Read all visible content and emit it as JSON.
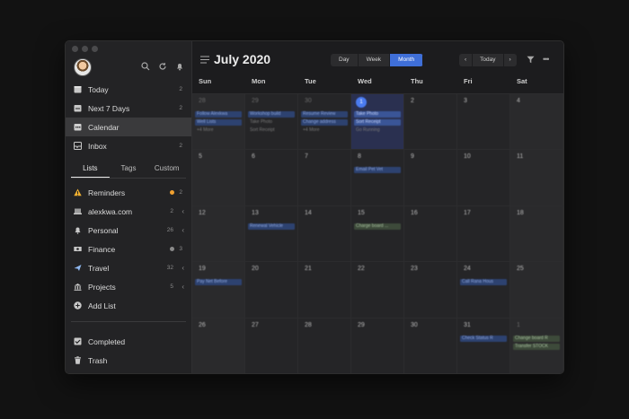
{
  "sidebar": {
    "nav": [
      {
        "label": "Today",
        "count": "2",
        "icon": "today-icon"
      },
      {
        "label": "Next 7 Days",
        "count": "2",
        "icon": "next-7-days-icon"
      },
      {
        "label": "Calendar",
        "count": "",
        "icon": "calendar-icon"
      },
      {
        "label": "Inbox",
        "count": "2",
        "icon": "inbox-icon"
      }
    ],
    "tabs": [
      "Lists",
      "Tags",
      "Custom"
    ],
    "lists": [
      {
        "label": "Reminders",
        "count": "2",
        "icon": "warning-icon",
        "dot": "#f0a030"
      },
      {
        "label": "alexkwa.com",
        "count": "2",
        "icon": "laptop-icon",
        "arrow": "‹"
      },
      {
        "label": "Personal",
        "count": "26",
        "icon": "bell-icon",
        "arrow": "‹"
      },
      {
        "label": "Finance",
        "count": "3",
        "icon": "money-icon",
        "dot": "#8a8a8a"
      },
      {
        "label": "Travel",
        "count": "32",
        "icon": "airplane-icon",
        "arrow": "‹"
      },
      {
        "label": "Projects",
        "count": "5",
        "icon": "building-icon",
        "arrow": "‹"
      }
    ],
    "add_list": "Add List",
    "bottom": [
      {
        "label": "Completed",
        "icon": "checkbox-icon"
      },
      {
        "label": "Trash",
        "icon": "trash-icon"
      }
    ]
  },
  "header": {
    "title": "July 2020",
    "views": [
      "Day",
      "Week",
      "Month"
    ],
    "active_view": "Month",
    "today_label": "Today",
    "prev": "‹",
    "next": "›",
    "more": "•••"
  },
  "weekdays": [
    "Sun",
    "Mon",
    "Tue",
    "Wed",
    "Thu",
    "Fri",
    "Sat"
  ],
  "calendar": {
    "weeks": [
      [
        "28",
        "29",
        "30",
        "1",
        "2",
        "3",
        "4"
      ],
      [
        "5",
        "6",
        "7",
        "8",
        "9",
        "10",
        "11"
      ],
      [
        "12",
        "13",
        "14",
        "15",
        "16",
        "17",
        "18"
      ],
      [
        "19",
        "20",
        "21",
        "22",
        "23",
        "24",
        "25"
      ],
      [
        "26",
        "27",
        "28",
        "29",
        "30",
        "31",
        "1"
      ]
    ],
    "today": "1",
    "events": [
      {
        "week": 0,
        "day": 0,
        "row": 0,
        "text": "Follow Alexkwa",
        "style": "blue"
      },
      {
        "week": 0,
        "day": 0,
        "row": 1,
        "text": "Well Lists",
        "style": "blue"
      },
      {
        "week": 0,
        "day": 0,
        "row": 2,
        "text": "+4 More",
        "style": "plain"
      },
      {
        "week": 0,
        "day": 1,
        "row": 0,
        "text": "Workshop build",
        "style": "blue"
      },
      {
        "week": 0,
        "day": 1,
        "row": 1,
        "text": "Take Photo",
        "style": "plain"
      },
      {
        "week": 0,
        "day": 1,
        "row": 2,
        "text": "Sort Receipt",
        "style": "plain"
      },
      {
        "week": 0,
        "day": 2,
        "row": 0,
        "text": "Resume Review",
        "style": "blue"
      },
      {
        "week": 0,
        "day": 2,
        "row": 1,
        "text": "Change address",
        "style": "blue"
      },
      {
        "week": 0,
        "day": 2,
        "row": 2,
        "text": "+4 More",
        "style": "plain"
      },
      {
        "week": 0,
        "day": 3,
        "row": 0,
        "text": "Take Photo",
        "style": "blue2"
      },
      {
        "week": 0,
        "day": 3,
        "row": 1,
        "text": "Sort Receipt",
        "style": "blue2"
      },
      {
        "week": 0,
        "day": 3,
        "row": 2,
        "text": "Go Running",
        "style": "plain"
      },
      {
        "week": 1,
        "day": 3,
        "row": 0,
        "text": "Email Pet Vet",
        "style": "blue"
      },
      {
        "week": 2,
        "day": 1,
        "row": 0,
        "text": "Renewal Vehicle",
        "style": "blue"
      },
      {
        "week": 2,
        "day": 3,
        "row": 0,
        "text": "Charge board ...",
        "style": "green"
      },
      {
        "week": 3,
        "day": 0,
        "row": 0,
        "text": "Pay Net Before",
        "style": "blue"
      },
      {
        "week": 3,
        "day": 5,
        "row": 0,
        "text": "Call Rana Hous",
        "style": "blue"
      },
      {
        "week": 4,
        "day": 5,
        "row": 0,
        "text": "Check Status R",
        "style": "blue"
      },
      {
        "week": 4,
        "day": 6,
        "row": 0,
        "text": "Change board R",
        "style": "green"
      },
      {
        "week": 4,
        "day": 6,
        "row": 1,
        "text": "Transfer STOCK",
        "style": "green"
      }
    ]
  },
  "colors": {
    "accent": "#3f6fd8",
    "today_bg": "#2a3050"
  }
}
